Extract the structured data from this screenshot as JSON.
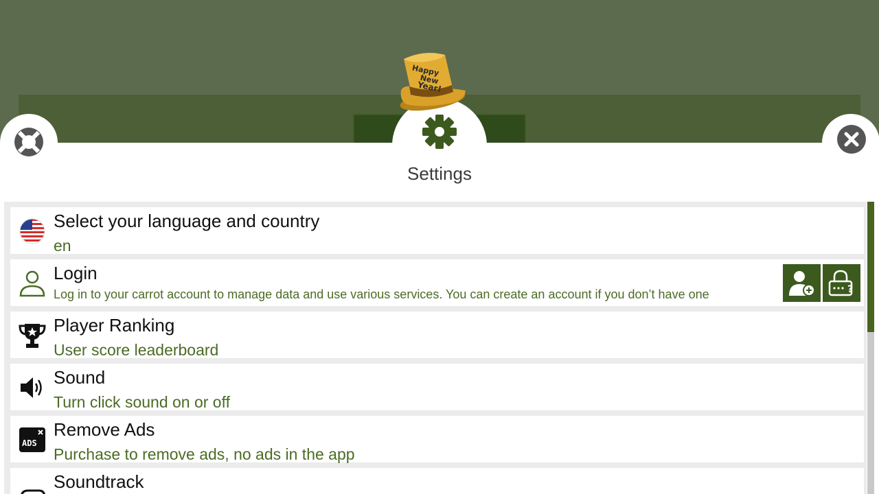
{
  "header": {
    "title": "Settings"
  },
  "icons": {
    "help": "lifebuoy-icon",
    "close": "close-icon",
    "settings": "gear-icon",
    "hat": "new-year-hat-icon"
  },
  "hat": {
    "line1": "Happy",
    "line2": "New",
    "line3": "Year!"
  },
  "colors": {
    "accent": "#3c5a1e",
    "subtitle": "#4b6b25",
    "background": "#5c6b4e"
  },
  "settings_items": [
    {
      "icon": "us-flag-icon",
      "title": "Select your language and country",
      "subtitle": "en"
    },
    {
      "icon": "user-icon",
      "title": "Login",
      "subtitle": "Log in to your carrot account to manage data and use various services. You can create an account if you don’t have one"
    },
    {
      "icon": "trophy-icon",
      "title": "Player Ranking",
      "subtitle": "User score leaderboard"
    },
    {
      "icon": "speaker-icon",
      "title": "Sound",
      "subtitle": "Turn click sound on or off"
    },
    {
      "icon": "ads-icon",
      "title": "Remove Ads",
      "subtitle": "Purchase to remove ads, no ads in the app"
    },
    {
      "icon": "music-icon",
      "title": "Soundtrack",
      "subtitle": ""
    }
  ],
  "login_actions": [
    {
      "icon": "add-user-icon"
    },
    {
      "icon": "password-recovery-icon"
    }
  ],
  "ads_icon_text": "ADS"
}
